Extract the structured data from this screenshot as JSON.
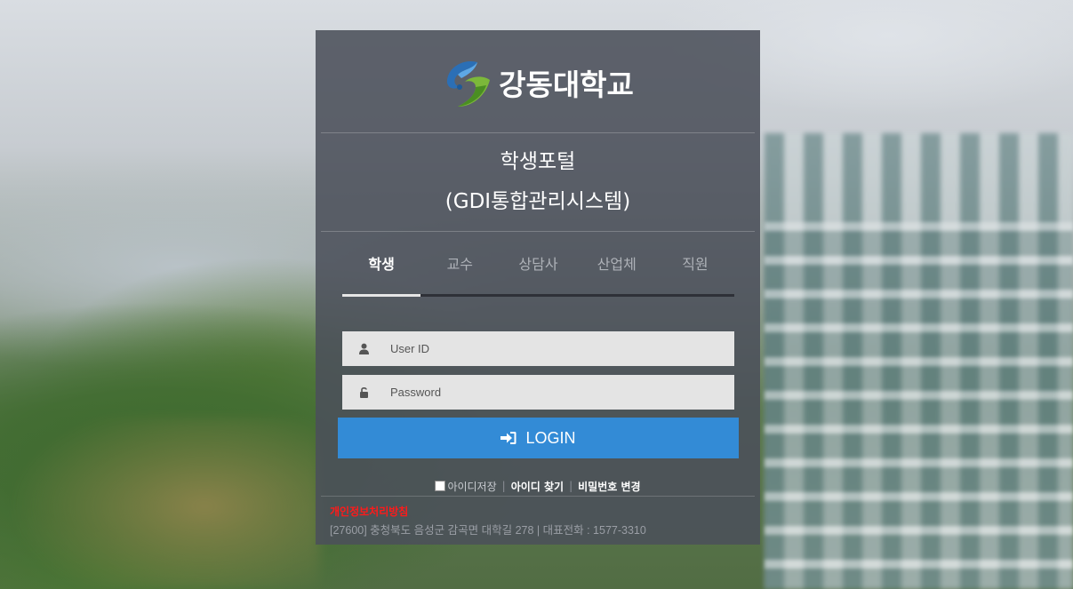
{
  "brand": {
    "name": "강동대학교"
  },
  "portal": {
    "title": "학생포털",
    "subtitle": "(GDI통합관리시스템)"
  },
  "tabs": [
    {
      "label": "학생",
      "active": true
    },
    {
      "label": "교수",
      "active": false
    },
    {
      "label": "상담사",
      "active": false
    },
    {
      "label": "산업체",
      "active": false
    },
    {
      "label": "직원",
      "active": false
    }
  ],
  "form": {
    "userid_placeholder": "User ID",
    "password_placeholder": "Password",
    "login_label": "LOGIN"
  },
  "links": {
    "remember_id": "아이디저장",
    "find_id": "아이디 찾기",
    "change_password": "비밀번호 변경"
  },
  "footer": {
    "privacy_policy": "개인정보처리방침",
    "address": "[27600] 충청북도 음성군 감곡면 대학길 278 | 대표전화 : 1577-3310"
  },
  "colors": {
    "login_button": "#338bd6",
    "privacy_link": "#ff1a1a",
    "panel": "#4b505a"
  }
}
